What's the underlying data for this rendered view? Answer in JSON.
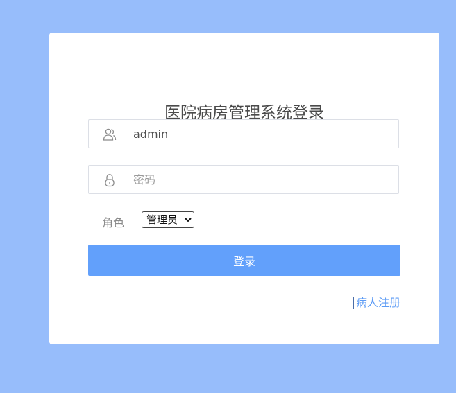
{
  "title": "医院病房管理系统登录",
  "username": {
    "value": "admin",
    "icon": "user-icon"
  },
  "password": {
    "placeholder": "密码",
    "icon": "lock-icon"
  },
  "role": {
    "label": "角色",
    "selected": "管理员"
  },
  "login_button": "登录",
  "register_link": "病人注册",
  "colors": {
    "background": "#97bdfb",
    "card": "#ffffff",
    "button": "#62a0fb",
    "link": "#5c9bf5"
  }
}
